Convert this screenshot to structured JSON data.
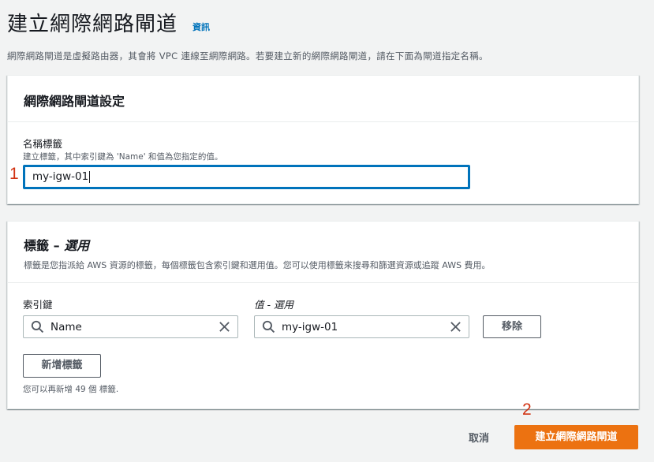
{
  "page": {
    "title": "建立網際網路閘道",
    "info_link": "資訊",
    "description": "網際網路閘道是虛擬路由器，其會將 VPC 連線至網際網路。若要建立新的網際網路閘道，請在下面為閘道指定名稱。"
  },
  "settings_panel": {
    "title": "網際網路閘道設定",
    "name_tag": {
      "label": "名稱標籤",
      "hint": "建立標籤，其中索引鍵為 'Name' 和值為您指定的值。",
      "value": "my-igw-01"
    }
  },
  "tags_panel": {
    "title_main": "標籤 – ",
    "title_optional": "選用",
    "subtitle": "標籤是您指派給 AWS 資源的標籤，每個標籤包含索引鍵和選用值。您可以使用標籤來搜尋和篩選資源或追蹤 AWS 費用。",
    "key_label": "索引鍵",
    "value_label": "值 - 選用",
    "key_value": "Name",
    "tag_value": "my-igw-01",
    "remove_button": "移除",
    "add_tag_button": "新增標籤",
    "limit_text": "您可以再新增 49 個 標籤."
  },
  "annotations": {
    "step1": "1",
    "step2": "2"
  },
  "footer": {
    "cancel": "取消",
    "create_button": "建立網際網路閘道"
  },
  "colors": {
    "primary": "#ec7211",
    "link": "#0073bb",
    "focus": "#0073bb",
    "annotation": "#d13212"
  }
}
